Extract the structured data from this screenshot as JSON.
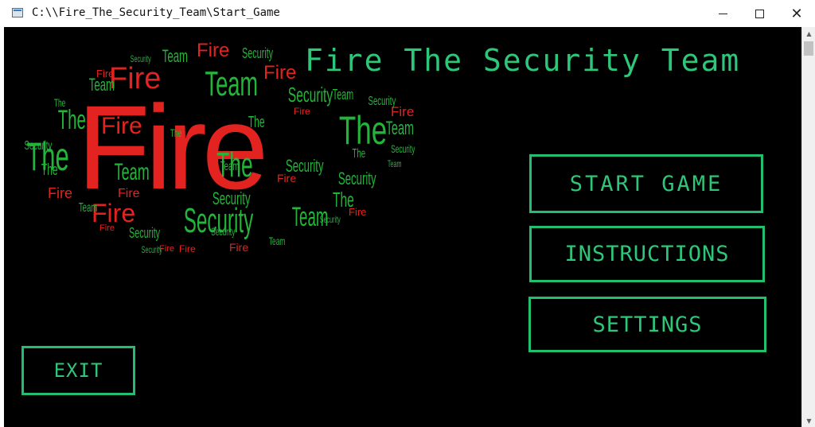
{
  "window": {
    "title": "C:\\\\Fire_The_Security_Team\\Start_Game",
    "minimize": "",
    "maximize": "",
    "close": "✕"
  },
  "game": {
    "title": "Fire The Security Team",
    "logo_words": [
      "Fire",
      "The",
      "Security",
      "Team"
    ]
  },
  "menu": {
    "start": "START GAME",
    "instructions": "INSTRUCTIONS",
    "settings": "SETTINGS",
    "exit": "EXIT"
  },
  "colors": {
    "background": "#000000",
    "accent_green": "#2ec77a",
    "logo_red": "#e3231f",
    "logo_green": "#22b53a"
  }
}
